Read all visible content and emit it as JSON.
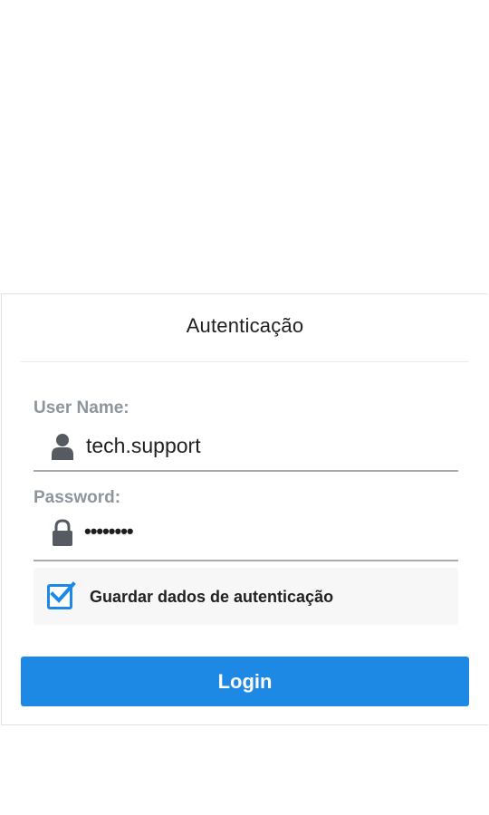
{
  "dialog": {
    "title": "Autenticação"
  },
  "form": {
    "username": {
      "label": "User Name:",
      "value": "tech.support",
      "icon": "user-icon"
    },
    "password": {
      "label": "Password:",
      "masked_value": "••••••••",
      "icon": "lock-icon"
    },
    "remember": {
      "label": "Guardar dados de autenticação",
      "checked": true
    },
    "login_label": "Login"
  },
  "colors": {
    "accent": "#1e88e5",
    "label": "#8d969d",
    "text": "#1f1f1f",
    "underline": "#a6abb0",
    "checkbox_bg": "#f7f7f7"
  }
}
